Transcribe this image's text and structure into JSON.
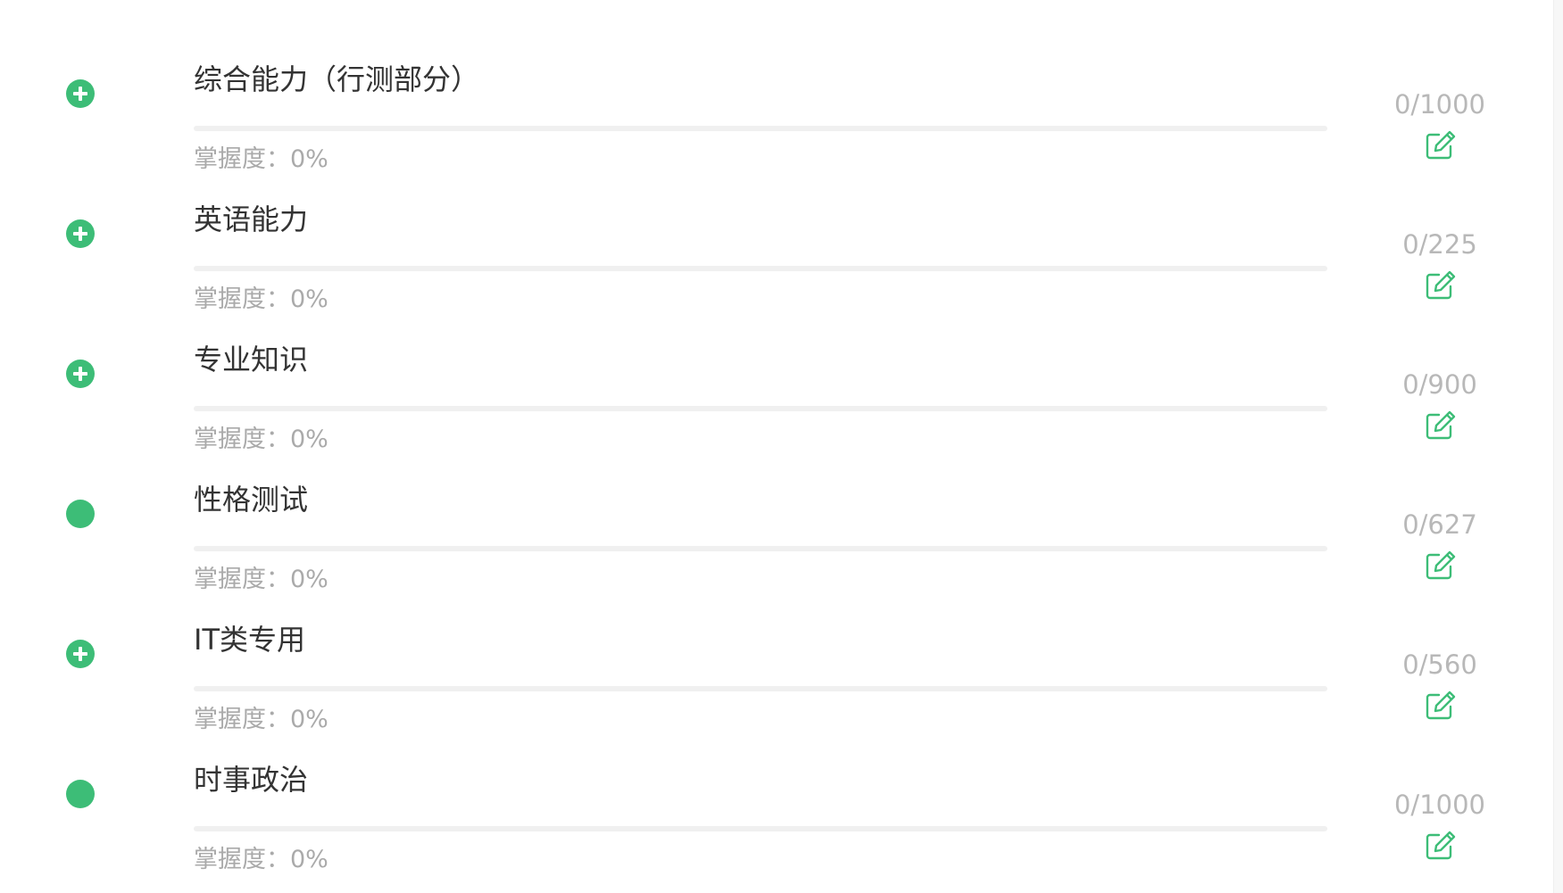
{
  "items": [
    {
      "title": "综合能力（行测部分）",
      "mastery_label": "掌握度：",
      "mastery_value": "0%",
      "mastery": 0,
      "count": "0/1000",
      "expandable": true
    },
    {
      "title": "英语能力",
      "mastery_label": "掌握度：",
      "mastery_value": "0%",
      "mastery": 0,
      "count": "0/225",
      "expandable": true
    },
    {
      "title": "专业知识",
      "mastery_label": "掌握度：",
      "mastery_value": "0%",
      "mastery": 0,
      "count": "0/900",
      "expandable": true
    },
    {
      "title": "性格测试",
      "mastery_label": "掌握度：",
      "mastery_value": "0%",
      "mastery": 0,
      "count": "0/627",
      "expandable": false
    },
    {
      "title": "IT类专用",
      "mastery_label": "掌握度：",
      "mastery_value": "0%",
      "mastery": 0,
      "count": "0/560",
      "expandable": true
    },
    {
      "title": "时事政治",
      "mastery_label": "掌握度：",
      "mastery_value": "0%",
      "mastery": 0,
      "count": "0/1000",
      "expandable": false
    }
  ],
  "colors": {
    "accent": "#3dbd77",
    "title": "#333333",
    "muted": "#aaaaaa",
    "count": "#b8b8b8",
    "track": "#f0f0f0"
  },
  "icons": {
    "expand": "plus-circle-icon",
    "leaf": "dot-circle-icon",
    "edit": "edit-icon"
  }
}
